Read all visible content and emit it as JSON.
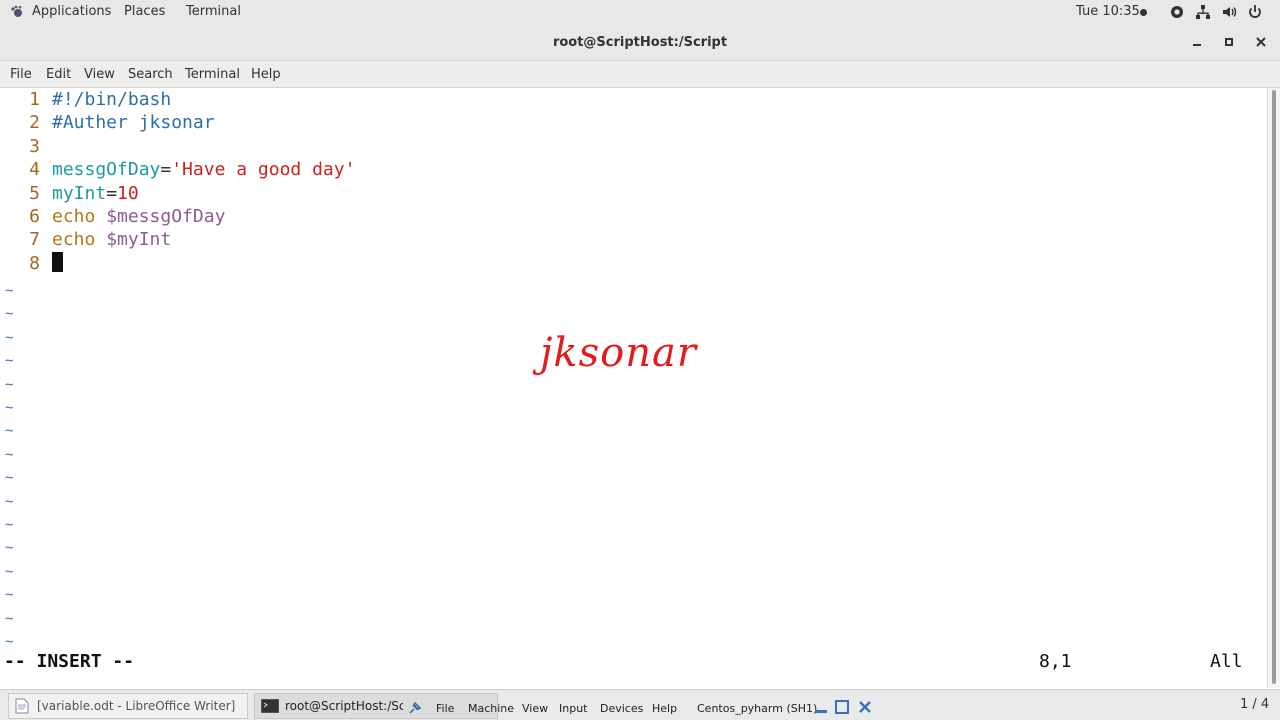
{
  "topbar": {
    "applications": "Applications",
    "places": "Places",
    "terminal": "Terminal",
    "clock": "Tue 10:35"
  },
  "window": {
    "title": "root@ScriptHost:/Script"
  },
  "menu": {
    "file": "File",
    "edit": "Edit",
    "view": "View",
    "search": "Search",
    "terminal": "Terminal",
    "help": "Help"
  },
  "editor": {
    "lines": [
      {
        "num": "1",
        "tokens": [
          {
            "cls": "c-comment",
            "text": "#!/bin/bash"
          }
        ]
      },
      {
        "num": "2",
        "tokens": [
          {
            "cls": "c-comment",
            "text": "#Auther jksonar"
          }
        ]
      },
      {
        "num": "3",
        "tokens": []
      },
      {
        "num": "4",
        "tokens": [
          {
            "cls": "c-var",
            "text": "messgOfDay"
          },
          {
            "cls": "c-op",
            "text": "="
          },
          {
            "cls": "c-str",
            "text": "'Have a good day'"
          }
        ]
      },
      {
        "num": "5",
        "tokens": [
          {
            "cls": "c-var",
            "text": "myInt"
          },
          {
            "cls": "c-op",
            "text": "="
          },
          {
            "cls": "c-num",
            "text": "10"
          }
        ]
      },
      {
        "num": "6",
        "tokens": [
          {
            "cls": "c-kw",
            "text": "echo"
          },
          {
            "cls": "c-op",
            "text": " "
          },
          {
            "cls": "c-ref",
            "text": "$messgOfDay"
          }
        ]
      },
      {
        "num": "7",
        "tokens": [
          {
            "cls": "c-kw",
            "text": "echo"
          },
          {
            "cls": "c-op",
            "text": " "
          },
          {
            "cls": "c-ref",
            "text": "$myInt"
          }
        ]
      },
      {
        "num": "8",
        "tokens": [],
        "cursor": true
      }
    ],
    "tilde": "~",
    "tilde_count": 16,
    "mode": "-- INSERT --",
    "position": "8,1",
    "scroll": "All"
  },
  "watermark": "jksonar",
  "taskbar": {
    "writer_task": "[variable.odt - LibreOffice Writer]",
    "terminal_task": "root@ScriptHost:/Sc",
    "vbox_menu": [
      "File",
      "Machine",
      "View",
      "Input",
      "Devices",
      "Help"
    ],
    "vm_name": "Centos_pyharm (SH1)",
    "pager": "1 / 4"
  },
  "colors": {
    "accent_red": "#e01c1c",
    "comment": "#2e6fa7",
    "variable": "#1f9aa0",
    "string": "#cc2121"
  }
}
